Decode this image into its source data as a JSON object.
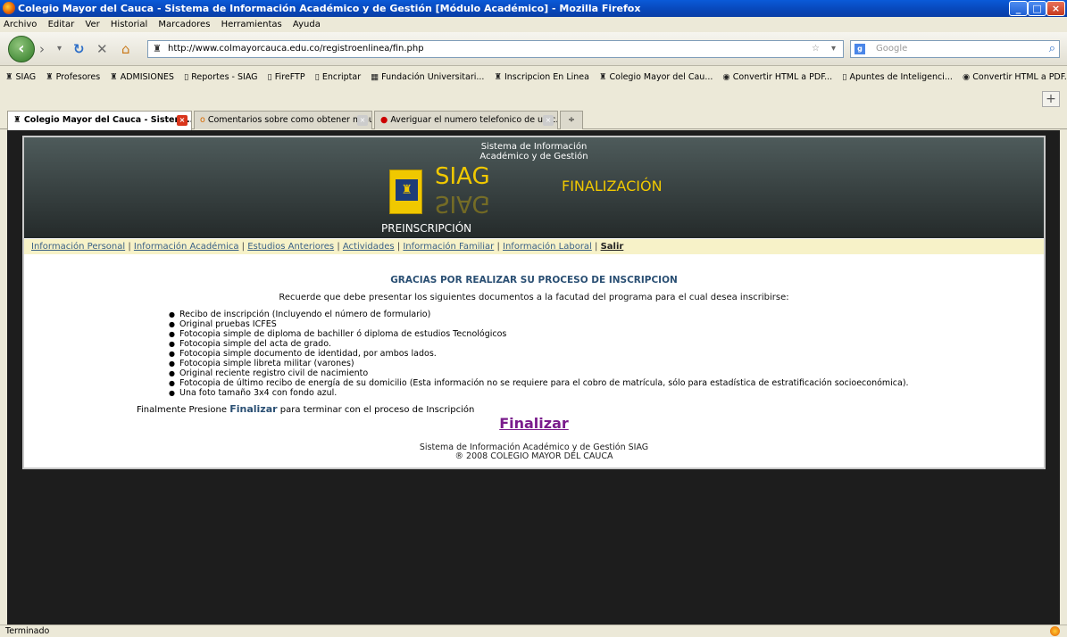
{
  "window": {
    "title": "Colegio Mayor del Cauca - Sistema de Información Académico y de Gestión [Módulo Académico] - Mozilla Firefox"
  },
  "menu": [
    "Archivo",
    "Editar",
    "Ver",
    "Historial",
    "Marcadores",
    "Herramientas",
    "Ayuda"
  ],
  "nav": {
    "url": "http://www.colmayorcauca.edu.co/registroenlinea/fin.php",
    "search_placeholder": "Google"
  },
  "bookmarks": [
    "SIAG",
    "Profesores",
    "ADMISIONES",
    "Reportes - SIAG",
    "FireFTP",
    "Encriptar",
    "Fundación Universitari...",
    "Inscripcion En Linea",
    "Colegio Mayor del Cau...",
    "Convertir HTML a PDF...",
    "Apuntes de Inteligenci...",
    "Convertir HTML a PDF..."
  ],
  "tabs": [
    "Colegio Mayor del Cauca - Sistem...",
    "Comentarios sobre como obtener minut...",
    "Averiguar el numero telefonico de un c..."
  ],
  "header": {
    "sistema_line1": "Sistema de Información",
    "sistema_line2": "Académico y de Gestión",
    "logo_text": "SIAG",
    "section": "FINALIZACIÓN",
    "subtitle": "PREINSCRIPCIÓN"
  },
  "sitenav": [
    "Información Personal",
    "Información Académica",
    "Estudios Anteriores",
    "Actividades",
    "Información Familiar",
    "Información Laboral",
    "Salir"
  ],
  "main": {
    "heading": "GRACIAS POR REALIZAR SU PROCESO DE INSCRIPCION",
    "intro": "Recuerde que debe presentar los siguientes documentos a la facutad del programa para el cual desea inscribirse:",
    "documents": [
      "Recibo de inscripción (Incluyendo el número de formulario)",
      "Original pruebas ICFES",
      "Fotocopia simple de diploma de bachiller ó diploma de estudios Tecnológicos",
      "Fotocopia simple del  acta de grado.",
      "Fotocopia simple documento de identidad, por ambos lados.",
      "Fotocopia simple libreta militar (varones)",
      "Original reciente registro civil de nacimiento",
      "Fotocopia de último recibo de energía de su domicilio (Esta información no se requiere para el cobro de matrícula, sólo para estadística de estratificación socioeconómica).",
      "Una foto tamaño 3x4 con fondo azul."
    ],
    "final_prefix": "Finalmente Presione",
    "final_word": "Finalizar",
    "final_suffix": "para terminar con el proceso de Inscripción",
    "final_button": "Finalizar",
    "footer_line1": "Sistema de Información Académico y de Gestión SIAG",
    "footer_line2": "® 2008 COLEGIO MAYOR DEL CAUCA"
  },
  "status": {
    "text": "Terminado"
  }
}
